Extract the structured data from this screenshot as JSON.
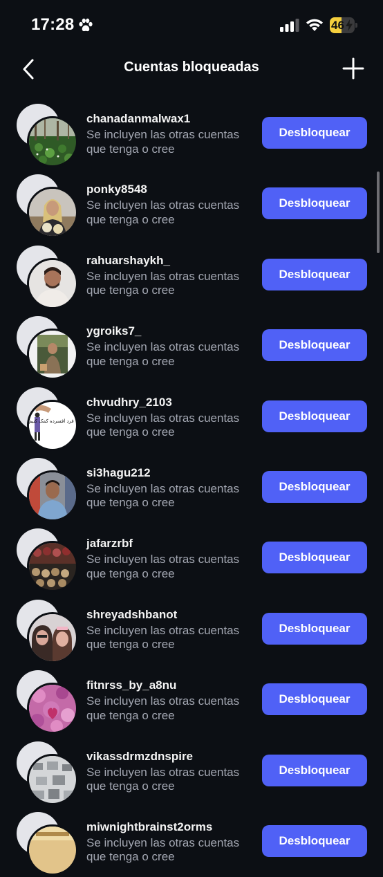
{
  "status_bar": {
    "time": "17:28",
    "battery": "46",
    "battery_level": 0.46,
    "icons": [
      "paw-icon",
      "signal-icon",
      "wifi-icon",
      "battery-icon",
      "bolt-icon"
    ]
  },
  "header": {
    "title": "Cuentas bloqueadas",
    "icons": [
      "back-chevron-icon",
      "plus-icon"
    ]
  },
  "colors": {
    "background": "#0c0f14",
    "button": "#5061f6",
    "subtitle": "#a4a8b3",
    "battery": "#f5cf3d"
  },
  "blocked_accounts": [
    {
      "username": "chanadanmalwax1",
      "subtitle": "Se incluyen las otras cuentas que tenga o cree",
      "button": "Desbloquear"
    },
    {
      "username": "ponky8548",
      "subtitle": "Se incluyen las otras cuentas que tenga o cree",
      "button": "Desbloquear"
    },
    {
      "username": "rahuarshaykh_",
      "subtitle": "Se incluyen las otras cuentas que tenga o cree",
      "button": "Desbloquear"
    },
    {
      "username": "ygroiks7_",
      "subtitle": "Se incluyen las otras cuentas que tenga o cree",
      "button": "Desbloquear"
    },
    {
      "username": "chvudhry_2103",
      "subtitle": "Se incluyen las otras cuentas que tenga o cree",
      "button": "Desbloquear",
      "avatar_text": "جطور به فرد افسرده کمک کنیم؟"
    },
    {
      "username": "si3hagu212",
      "subtitle": "Se incluyen las otras cuentas que tenga o cree",
      "button": "Desbloquear"
    },
    {
      "username": "jafarzrbf",
      "subtitle": "Se incluyen las otras cuentas que tenga o cree",
      "button": "Desbloquear"
    },
    {
      "username": "shreyadshbanot",
      "subtitle": "Se incluyen las otras cuentas que tenga o cree",
      "button": "Desbloquear"
    },
    {
      "username": "fitnrss_by_a8nu",
      "subtitle": "Se incluyen las otras cuentas que tenga o cree",
      "button": "Desbloquear"
    },
    {
      "username": "vikassdrmzdnspire",
      "subtitle": "Se incluyen las otras cuentas que tenga o cree",
      "button": "Desbloquear"
    },
    {
      "username": "miwnightbrainst2orms",
      "subtitle": "Se incluyen las otras cuentas que tenga o cree",
      "button": "Desbloquear"
    }
  ]
}
